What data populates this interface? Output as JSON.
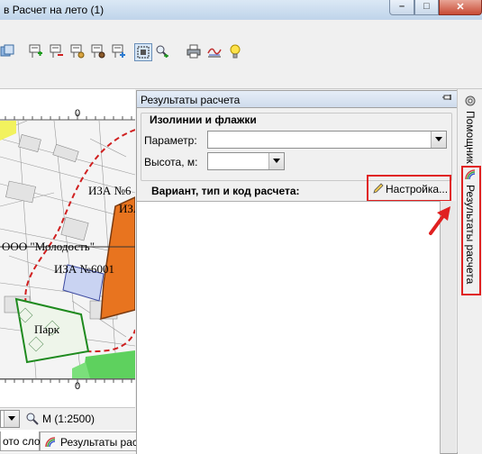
{
  "window": {
    "title": "в Расчет на лето (1)",
    "buttons": {
      "minimize": "–",
      "maximize": "□",
      "close": "✕"
    }
  },
  "toolbar": {
    "icons": [
      "layer-icon",
      "add-source-icon",
      "remove-source-icon",
      "edit-source-icon",
      "view-source-icon",
      "copy-source-icon",
      "select-icon",
      "search-icon",
      "print-icon",
      "graph-icon",
      "lightbulb-icon"
    ]
  },
  "map": {
    "ruler_top_label": "0",
    "ruler_bottom_label": "0",
    "labels": {
      "iza_top": "ИЗА №6",
      "iza_partial": "ИЗА",
      "company": "ООО \"Молодость\"",
      "iza_main": "ИЗА №6001",
      "park": "Парк"
    },
    "scale_label": "М (1:2500)"
  },
  "results_panel": {
    "title": "Результаты расчета",
    "group_title": "Изолинии и флажки",
    "parameter_label": "Параметр:",
    "parameter_value": "",
    "height_label": "Высота, м:",
    "height_value": "",
    "variant_label": "Вариант, тип и код расчета:",
    "settings_button": "Настройка..."
  },
  "right_tabs": {
    "helper": "Помощник",
    "results": "Результаты расчета"
  },
  "bottom_tabs": {
    "layer_tab": "ото слоя",
    "results_tab": "Результаты расч"
  },
  "colors": {
    "highlight": "#e02020",
    "map_orange": "#e8741f",
    "map_blue": "#c9d3f2",
    "map_green": "#5ed15e",
    "map_yellow": "#f2f25e"
  }
}
